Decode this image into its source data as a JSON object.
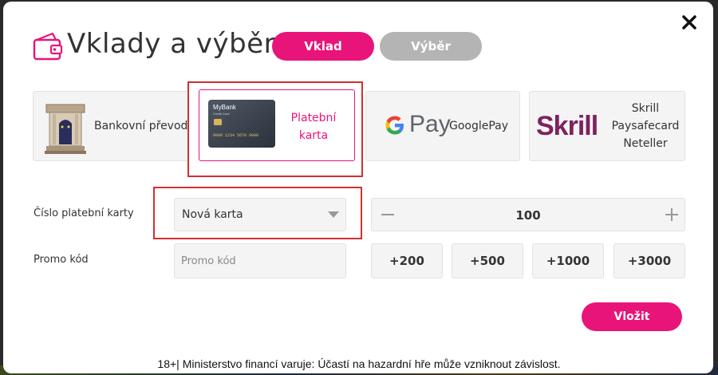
{
  "header": {
    "title": "Vklady a výběry",
    "tabs": {
      "deposit": "Vklad",
      "withdraw": "Výběr"
    },
    "active_tab": "deposit"
  },
  "methods": {
    "bank": {
      "label": "Bankovní převod",
      "icon": "bank-icon"
    },
    "card": {
      "label_line1": "Platební",
      "label_line2": "karta",
      "selected": true,
      "card_brand": "MyBank",
      "card_subtitle": "Credit Card",
      "card_number": "0000 1234 5678 9000"
    },
    "googlepay": {
      "logo_text": "Pay",
      "label": "GooglePay"
    },
    "skrill": {
      "logo_text": "Skrill",
      "labels": [
        "Skrill",
        "Paysafecard",
        "Neteller"
      ]
    }
  },
  "form": {
    "card_number_label": "Číslo platební karty",
    "card_select_value": "Nová karta",
    "promo_label": "Promo kód",
    "promo_placeholder": "Promo kód",
    "amount": "100",
    "quick_amounts": [
      "+200",
      "+500",
      "+1000",
      "+3000"
    ],
    "submit_label": "Vložit"
  },
  "disclaimer": "18+| Ministerstvo financí varuje: Účastí na hazardní hře může vzniknout závislost.",
  "colors": {
    "accent": "#e8147a",
    "inactive_tab": "#b4b4b4",
    "highlight_outline": "#d32f2f",
    "skrill": "#7d2260"
  }
}
